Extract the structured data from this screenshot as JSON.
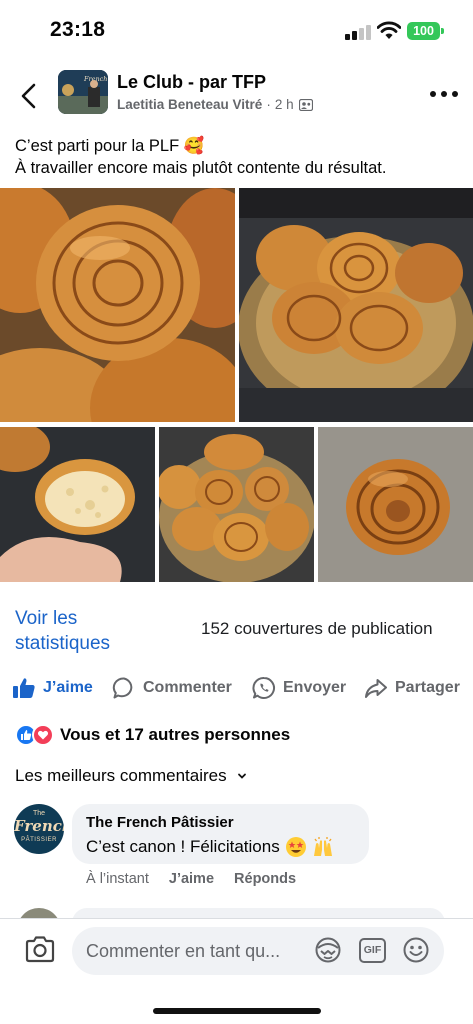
{
  "status_bar": {
    "time": "23:18",
    "battery": "100",
    "colors": {
      "battery": "#34c759"
    }
  },
  "header": {
    "group_name": "Le Club - par TFP",
    "author": "Laetitia Beneteau Vitré",
    "time_ago": "2 h",
    "separator": "·",
    "icons": {
      "back": "chevron-left-icon",
      "audience": "group-members-icon",
      "more": "more-dots-icon"
    }
  },
  "post": {
    "lines": [
      "C’est parti pour la PLF 🥰",
      "À travailler encore mais plutôt contente du résultat."
    ],
    "photos": [
      "croissants-closeup-photo",
      "croissants-bowl-photo",
      "croissant-crumb-cut-photo",
      "croissants-tray-photo",
      "single-croissant-photo"
    ]
  },
  "stats": {
    "link": "Voir les statistiques",
    "reach": "152 couvertures de publication"
  },
  "actions": {
    "like": "J’aime",
    "comment": "Commenter",
    "send": "Envoyer",
    "share": "Partager"
  },
  "reactions": {
    "text": "Vous et 17 autres personnes",
    "types": [
      "like",
      "love"
    ]
  },
  "comments": {
    "sort_label": "Les meilleurs commentaires",
    "items": [
      {
        "author": "The French Pâtissier",
        "text": "C’est canon ! Félicitations",
        "emojis": [
          "star-struck-emoji",
          "raised-hands-emoji"
        ],
        "avatar_text": {
          "top": "The",
          "middle": "French",
          "bottom": "PÂTISSIER"
        },
        "time": "À l’instant",
        "like": "J’aime",
        "reply": "Réponds"
      }
    ]
  },
  "composer": {
    "placeholder": "Commenter en tant qu...",
    "gif": "GIF",
    "icons": {
      "camera": "camera-icon",
      "avatar": "avatar-sticker-icon",
      "gif": "gif-icon",
      "emoji": "emoji-icon"
    }
  },
  "colors": {
    "link_blue": "#1b64c9",
    "muted": "#65676b",
    "bubble": "#f0f2f5"
  }
}
